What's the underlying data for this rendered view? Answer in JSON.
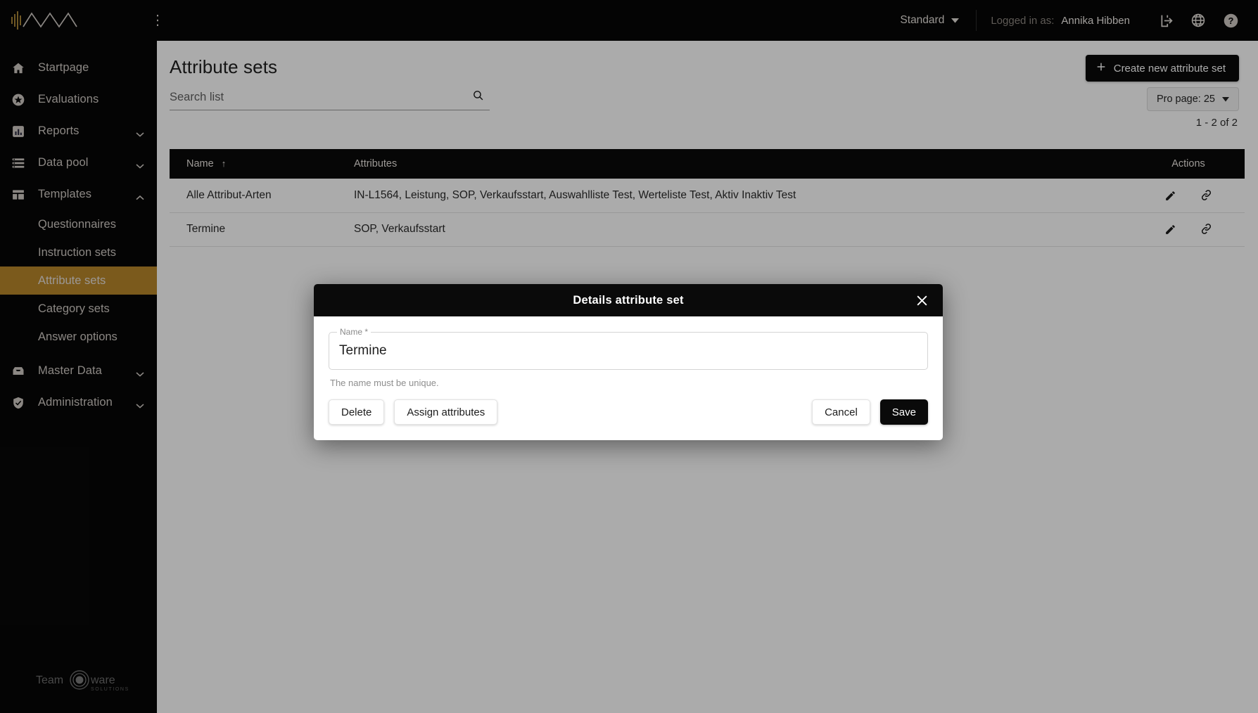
{
  "brand": {
    "logo_icon": "waveform-logo"
  },
  "header": {
    "collapse_icon": "menu-collapse-icon",
    "theme_label": "Standard",
    "theme_caret_icon": "caret-down-icon",
    "logged_in_label": "Logged in as:",
    "user_name": "Annika Hibben",
    "logout_icon": "logout-icon",
    "language_icon": "globe-icon",
    "help_icon": "help-icon"
  },
  "sidebar": {
    "items": [
      {
        "label": "Startpage",
        "icon": "home-icon",
        "expandable": false
      },
      {
        "label": "Evaluations",
        "icon": "star-icon",
        "expandable": false
      },
      {
        "label": "Reports",
        "icon": "bar-chart-icon",
        "expandable": true
      },
      {
        "label": "Data pool",
        "icon": "database-list-icon",
        "expandable": true
      },
      {
        "label": "Templates",
        "icon": "layout-template-icon",
        "expandable": true,
        "expanded": true
      }
    ],
    "templates_children": [
      {
        "label": "Questionnaires",
        "active": false
      },
      {
        "label": "Instruction sets",
        "active": false
      },
      {
        "label": "Attribute sets",
        "active": true
      },
      {
        "label": "Category sets",
        "active": false
      },
      {
        "label": "Answer options",
        "active": false
      }
    ],
    "items_bottom": [
      {
        "label": "Master Data",
        "icon": "inbox-icon",
        "expandable": true
      },
      {
        "label": "Administration",
        "icon": "shield-check-icon",
        "expandable": true
      }
    ],
    "footer_logo": "teamware-solutions-logo"
  },
  "page": {
    "title": "Attribute sets",
    "search_placeholder": "Search list",
    "search_value": "",
    "search_icon": "search-icon",
    "create_button_label": "Create new attribute set",
    "create_button_icon": "plus-icon",
    "per_page_label": "Pro page: 25",
    "per_page_caret_icon": "caret-down-icon",
    "range_text": "1 - 2 of 2"
  },
  "table": {
    "columns": [
      "Name",
      "Attributes",
      "Actions"
    ],
    "sort_column": "Name",
    "sort_icon": "arrow-up-icon",
    "rows": [
      {
        "name": "Alle Attribut-Arten",
        "attributes": "IN-L1564, Leistung, SOP, Verkaufsstart, Auswahlliste Test, Werteliste Test, Aktiv Inaktiv Test",
        "edit_icon": "pencil-icon",
        "link_icon": "link-icon"
      },
      {
        "name": "Termine",
        "attributes": "SOP, Verkaufsstart",
        "edit_icon": "pencil-icon",
        "link_icon": "link-icon"
      }
    ]
  },
  "modal": {
    "title": "Details attribute set",
    "close_icon": "close-icon",
    "name_field_label": "Name *",
    "name_field_value": "Termine",
    "hint": "The name must be unique.",
    "delete_label": "Delete",
    "assign_label": "Assign attributes",
    "cancel_label": "Cancel",
    "save_label": "Save"
  },
  "colors": {
    "accent_gold": "#b8862b",
    "dark": "#070707",
    "overlay": "rgba(0,0,0,0.33)"
  }
}
